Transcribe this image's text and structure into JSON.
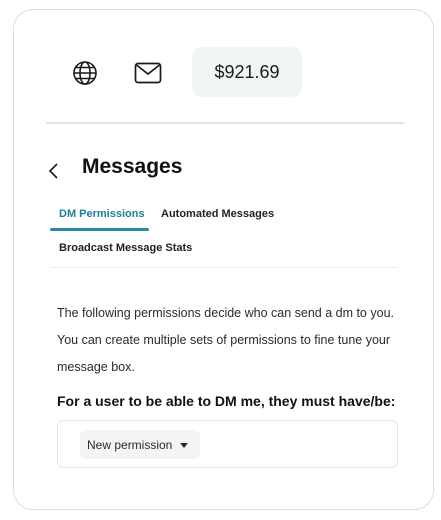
{
  "header": {
    "icons": [
      "globe-icon",
      "mail-icon"
    ],
    "balance": "$921.69"
  },
  "page": {
    "title": "Messages",
    "back_icon": "chevron-left-icon"
  },
  "tabs": [
    {
      "label": "DM Permissions",
      "active": true
    },
    {
      "label": "Automated Messages",
      "active": false
    },
    {
      "label": "Broadcast Message Stats",
      "active": false
    }
  ],
  "content": {
    "description": "The following permissions decide who can send a dm to you. You can create multiple sets of permissions to fine tune your message box.",
    "requirement_heading": "For a user to be able to DM me, they must have/be:",
    "new_permission_label": "New permission"
  },
  "colors": {
    "accent": "#1e7f9a",
    "balance_bg": "#f1f4f5"
  }
}
